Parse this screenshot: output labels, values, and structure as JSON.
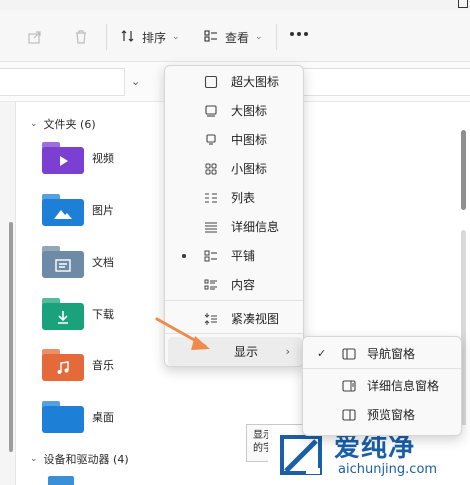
{
  "toolbar": {
    "sort_label": "排序",
    "view_label": "查看"
  },
  "groups": {
    "folders_header": "文件夹 (6)",
    "drives_header": "设备和驱动器 (4)"
  },
  "folders": [
    {
      "name": "视频",
      "icon": "video-folder-icon",
      "color": "#7b3fd1"
    },
    {
      "name": "图片",
      "icon": "pictures-folder-icon",
      "color": "#1e7fd6"
    },
    {
      "name": "文档",
      "icon": "documents-folder-icon",
      "color": "#6d8aa6"
    },
    {
      "name": "下载",
      "icon": "downloads-folder-icon",
      "color": "#1aa37a"
    },
    {
      "name": "音乐",
      "icon": "music-folder-icon",
      "color": "#e56a3a"
    },
    {
      "name": "桌面",
      "icon": "desktop-folder-icon",
      "color": "#1e7fd6"
    }
  ],
  "view_menu": {
    "items": [
      {
        "label": "超大图标",
        "icon": "extra-large-icons-icon"
      },
      {
        "label": "大图标",
        "icon": "large-icons-icon"
      },
      {
        "label": "中图标",
        "icon": "medium-icons-icon"
      },
      {
        "label": "小图标",
        "icon": "small-icons-icon"
      },
      {
        "label": "列表",
        "icon": "list-icon"
      },
      {
        "label": "详细信息",
        "icon": "details-icon"
      },
      {
        "label": "平铺",
        "icon": "tiles-icon",
        "selected": true
      },
      {
        "label": "内容",
        "icon": "content-icon"
      },
      {
        "label": "紧凑视图",
        "icon": "compact-view-icon"
      },
      {
        "label": "显示",
        "icon": "",
        "has_submenu": true,
        "highlighted": true
      }
    ]
  },
  "show_submenu": {
    "items": [
      {
        "label": "导航窗格",
        "icon": "navigation-pane-icon",
        "checked": true
      },
      {
        "label": "详细信息窗格",
        "icon": "details-pane-icon"
      },
      {
        "label": "预览窗格",
        "icon": "preview-pane-icon"
      }
    ]
  },
  "tooltip": {
    "line1": "显示",
    "line2": "的字"
  },
  "watermark": {
    "brand": "爱纯净",
    "url": "aichunjing.com",
    "color": "#1b5fa8"
  },
  "accent_colors": {
    "arrow": "#f08a4b"
  }
}
